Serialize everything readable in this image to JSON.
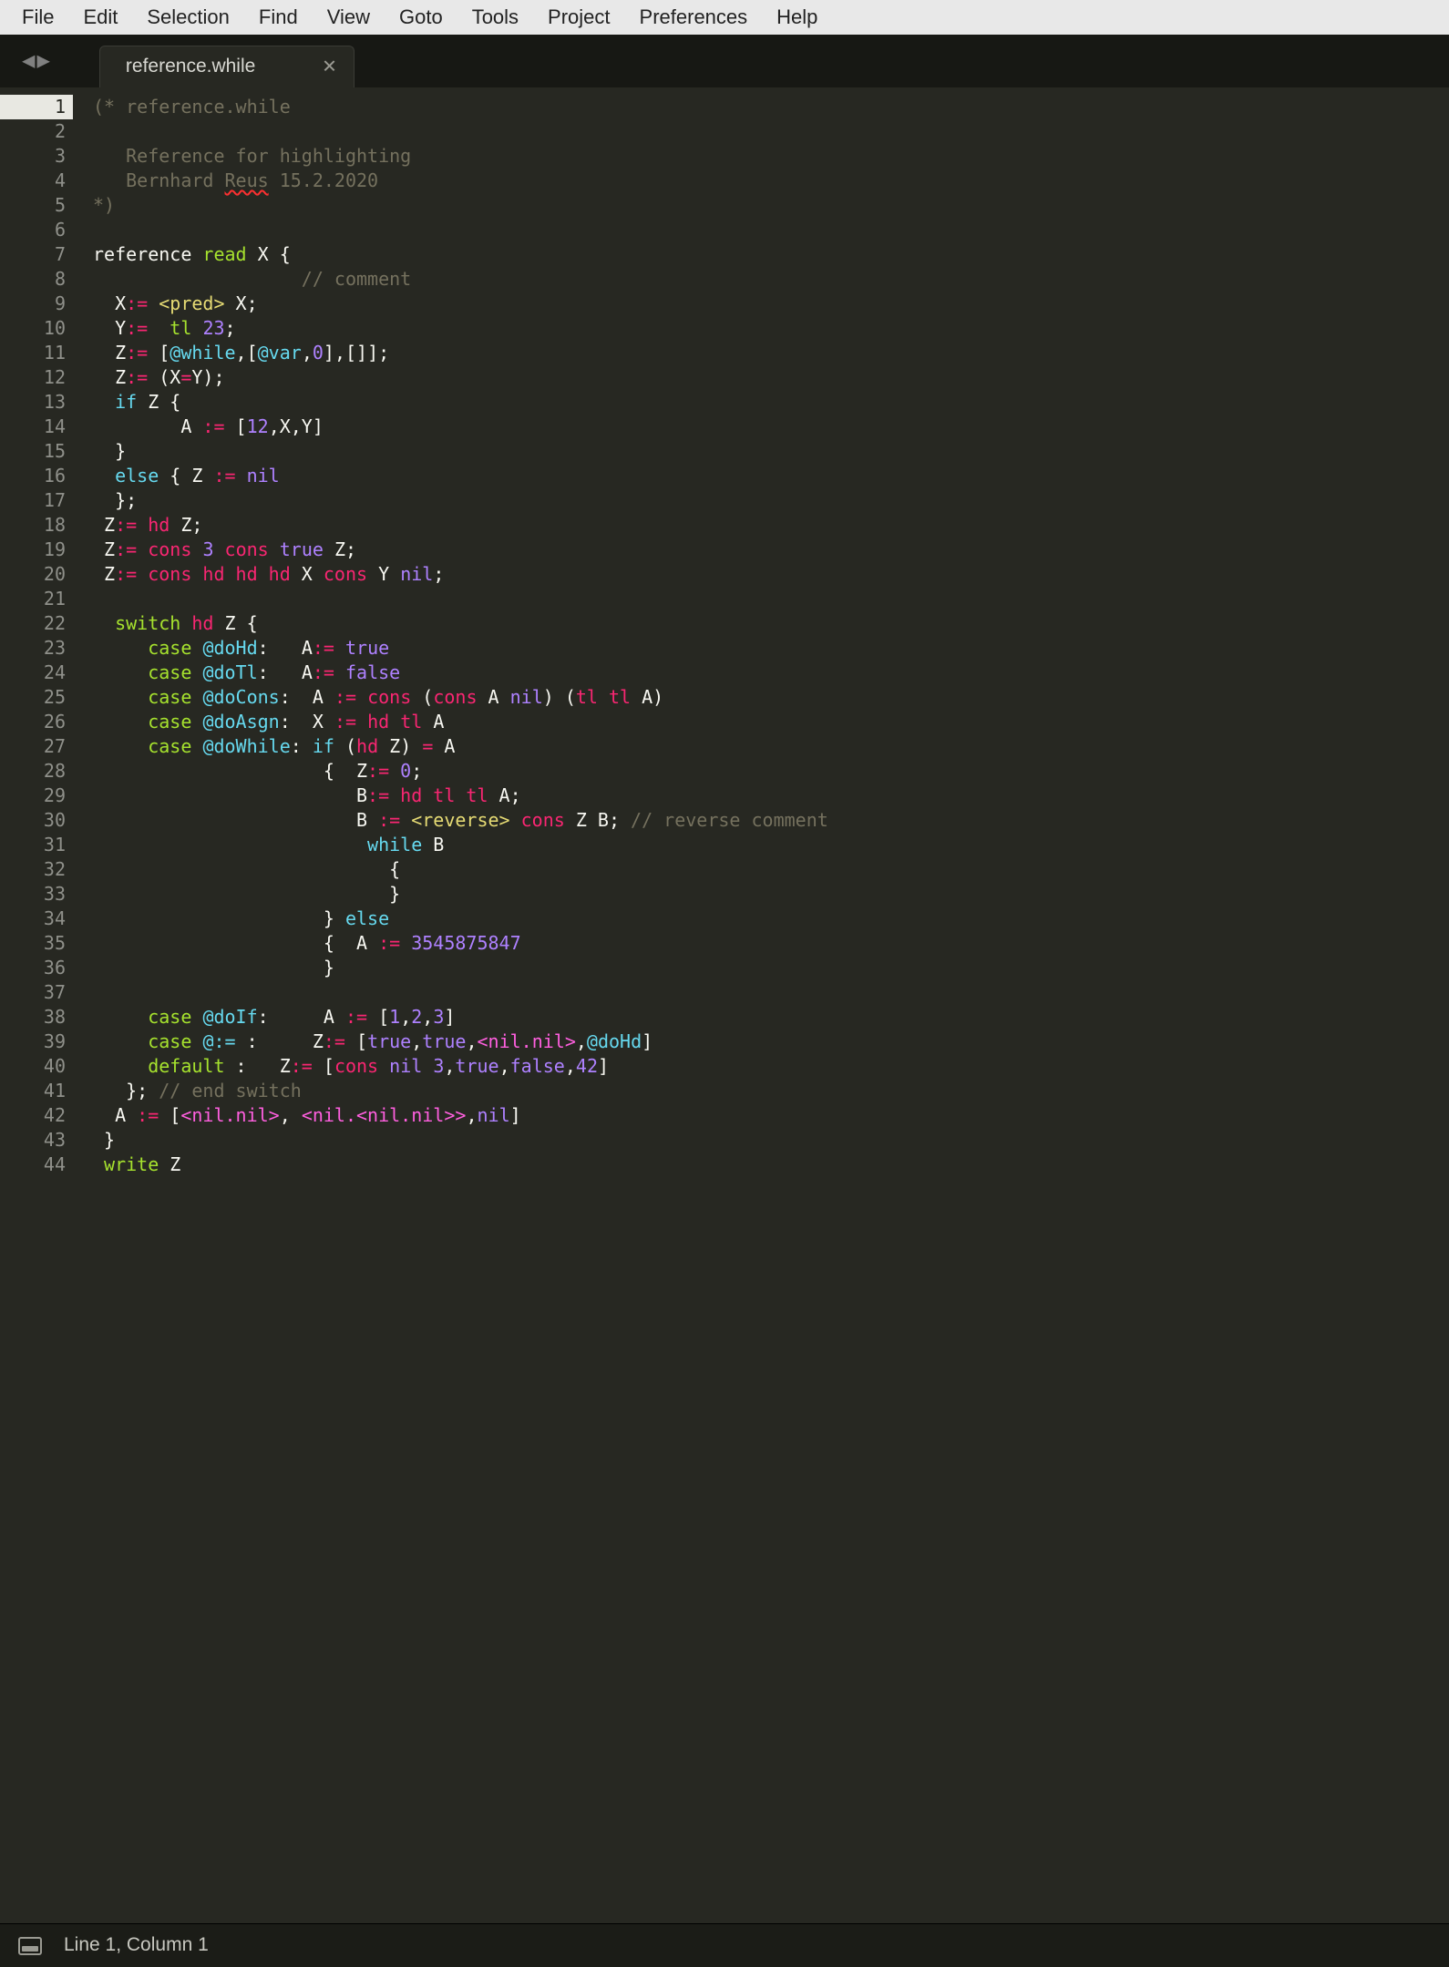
{
  "menu": {
    "items": [
      "File",
      "Edit",
      "Selection",
      "Find",
      "View",
      "Goto",
      "Tools",
      "Project",
      "Preferences",
      "Help"
    ]
  },
  "tabs": {
    "active": {
      "title": "reference.while"
    }
  },
  "nav": {
    "back": "◀",
    "forward": "▶"
  },
  "status": {
    "pos": "Line 1, Column 1"
  },
  "editor": {
    "line_count": 44,
    "current_line": 1
  },
  "code": {
    "l1": [
      [
        "c-cmt",
        "(* reference.while"
      ]
    ],
    "l2": [
      [
        "c-white",
        ""
      ]
    ],
    "l3": [
      [
        "c-cmt",
        "   Reference for highlighting"
      ]
    ],
    "l4": [
      [
        "c-cmt",
        "   Bernhard "
      ],
      [
        "c-cmt spell-err",
        "Reus"
      ],
      [
        "c-cmt",
        " 15.2.2020"
      ]
    ],
    "l5": [
      [
        "c-cmt",
        "*)"
      ]
    ],
    "l6": [
      [
        "c-white",
        ""
      ]
    ],
    "l7": [
      [
        "c-white",
        "reference "
      ],
      [
        "c-fn",
        "read"
      ],
      [
        "c-white",
        " X {"
      ]
    ],
    "l8": [
      [
        "c-white",
        "                   "
      ],
      [
        "c-cmt",
        "// comment"
      ]
    ],
    "l9": [
      [
        "c-white",
        "  X"
      ],
      [
        "c-red",
        ":= "
      ],
      [
        "c-yellow",
        "<pred>"
      ],
      [
        "c-white",
        " X;"
      ]
    ],
    "l10": [
      [
        "c-white",
        "  Y"
      ],
      [
        "c-red",
        ":=  "
      ],
      [
        "c-fn",
        "tl"
      ],
      [
        "c-white",
        " "
      ],
      [
        "c-purple",
        "23"
      ],
      [
        "c-white",
        ";"
      ]
    ],
    "l11": [
      [
        "c-white",
        "  Z"
      ],
      [
        "c-red",
        ":= "
      ],
      [
        "c-white",
        "["
      ],
      [
        "c-cyan",
        "@while"
      ],
      [
        "c-white",
        ",["
      ],
      [
        "c-cyan",
        "@var"
      ],
      [
        "c-white",
        ","
      ],
      [
        "c-purple",
        "0"
      ],
      [
        "c-white",
        "],[]];"
      ]
    ],
    "l12": [
      [
        "c-white",
        "  Z"
      ],
      [
        "c-red",
        ":= "
      ],
      [
        "c-white",
        "(X"
      ],
      [
        "c-red",
        "="
      ],
      [
        "c-white",
        "Y);"
      ]
    ],
    "l13": [
      [
        "c-cyan",
        "  if"
      ],
      [
        "c-white",
        " Z {"
      ]
    ],
    "l14": [
      [
        "c-white",
        "        A "
      ],
      [
        "c-red",
        ":= "
      ],
      [
        "c-white",
        "["
      ],
      [
        "c-purple",
        "12"
      ],
      [
        "c-white",
        ",X,Y]"
      ]
    ],
    "l15": [
      [
        "c-white",
        "  }"
      ]
    ],
    "l16": [
      [
        "c-cyan",
        "  else"
      ],
      [
        "c-white",
        " { Z "
      ],
      [
        "c-red",
        ":= "
      ],
      [
        "c-purple",
        "nil"
      ]
    ],
    "l17": [
      [
        "c-white",
        "  };"
      ]
    ],
    "l18": [
      [
        "c-white",
        " Z"
      ],
      [
        "c-red",
        ":= "
      ],
      [
        "c-red",
        "hd"
      ],
      [
        "c-white",
        " Z;"
      ]
    ],
    "l19": [
      [
        "c-white",
        " Z"
      ],
      [
        "c-red",
        ":= "
      ],
      [
        "c-red",
        "cons "
      ],
      [
        "c-purple",
        "3"
      ],
      [
        "c-white",
        " "
      ],
      [
        "c-red",
        "cons "
      ],
      [
        "c-purple",
        "true"
      ],
      [
        "c-white",
        " Z;"
      ]
    ],
    "l20": [
      [
        "c-white",
        " Z"
      ],
      [
        "c-red",
        ":= "
      ],
      [
        "c-red",
        "cons hd hd hd"
      ],
      [
        "c-white",
        " X "
      ],
      [
        "c-red",
        "cons"
      ],
      [
        "c-white",
        " Y "
      ],
      [
        "c-purple",
        "nil"
      ],
      [
        "c-white",
        ";"
      ]
    ],
    "l21": [
      [
        "c-white",
        ""
      ]
    ],
    "l22": [
      [
        "c-white",
        "  "
      ],
      [
        "c-fn",
        "switch"
      ],
      [
        "c-white",
        " "
      ],
      [
        "c-red",
        "hd"
      ],
      [
        "c-white",
        " Z {"
      ]
    ],
    "l23": [
      [
        "c-white",
        "     "
      ],
      [
        "c-fn",
        "case"
      ],
      [
        "c-white",
        " "
      ],
      [
        "c-cyan",
        "@doHd"
      ],
      [
        "c-white",
        ":   A"
      ],
      [
        "c-red",
        ":= "
      ],
      [
        "c-purple",
        "true"
      ]
    ],
    "l24": [
      [
        "c-white",
        "     "
      ],
      [
        "c-fn",
        "case"
      ],
      [
        "c-white",
        " "
      ],
      [
        "c-cyan",
        "@doTl"
      ],
      [
        "c-white",
        ":   A"
      ],
      [
        "c-red",
        ":= "
      ],
      [
        "c-purple",
        "false"
      ]
    ],
    "l25": [
      [
        "c-white",
        "     "
      ],
      [
        "c-fn",
        "case"
      ],
      [
        "c-white",
        " "
      ],
      [
        "c-cyan",
        "@doCons"
      ],
      [
        "c-white",
        ":  A "
      ],
      [
        "c-red",
        ":= cons "
      ],
      [
        "c-white",
        "("
      ],
      [
        "c-red",
        "cons"
      ],
      [
        "c-white",
        " A "
      ],
      [
        "c-purple",
        "nil"
      ],
      [
        "c-white",
        ") ("
      ],
      [
        "c-red",
        "tl tl"
      ],
      [
        "c-white",
        " A)"
      ]
    ],
    "l26": [
      [
        "c-white",
        "     "
      ],
      [
        "c-fn",
        "case"
      ],
      [
        "c-white",
        " "
      ],
      [
        "c-cyan",
        "@doAsgn"
      ],
      [
        "c-white",
        ":  X "
      ],
      [
        "c-red",
        ":= hd tl"
      ],
      [
        "c-white",
        " A"
      ]
    ],
    "l27": [
      [
        "c-white",
        "     "
      ],
      [
        "c-fn",
        "case"
      ],
      [
        "c-white",
        " "
      ],
      [
        "c-cyan",
        "@doWhile"
      ],
      [
        "c-white",
        ": "
      ],
      [
        "c-cyan",
        "if"
      ],
      [
        "c-white",
        " ("
      ],
      [
        "c-red",
        "hd"
      ],
      [
        "c-white",
        " Z) "
      ],
      [
        "c-red",
        "="
      ],
      [
        "c-white",
        " A"
      ]
    ],
    "l28": [
      [
        "c-white",
        "                     {  Z"
      ],
      [
        "c-red",
        ":= "
      ],
      [
        "c-purple",
        "0"
      ],
      [
        "c-white",
        ";"
      ]
    ],
    "l29": [
      [
        "c-white",
        "                        B"
      ],
      [
        "c-red",
        ":= hd tl tl"
      ],
      [
        "c-white",
        " A;"
      ]
    ],
    "l30": [
      [
        "c-white",
        "                        B "
      ],
      [
        "c-red",
        ":= "
      ],
      [
        "c-yellow",
        "<reverse>"
      ],
      [
        "c-white",
        " "
      ],
      [
        "c-red",
        "cons"
      ],
      [
        "c-white",
        " Z B; "
      ],
      [
        "c-cmt",
        "// reverse comment"
      ]
    ],
    "l31": [
      [
        "c-white",
        "                         "
      ],
      [
        "c-cyan",
        "while"
      ],
      [
        "c-white",
        " B"
      ]
    ],
    "l32": [
      [
        "c-white",
        "                           {"
      ]
    ],
    "l33": [
      [
        "c-white",
        "                           }"
      ]
    ],
    "l34": [
      [
        "c-white",
        "                     } "
      ],
      [
        "c-cyan",
        "else"
      ]
    ],
    "l35": [
      [
        "c-white",
        "                     {  A "
      ],
      [
        "c-red",
        ":= "
      ],
      [
        "c-purple",
        "3545875847"
      ]
    ],
    "l36": [
      [
        "c-white",
        "                     }"
      ]
    ],
    "l37": [
      [
        "c-white",
        ""
      ]
    ],
    "l38": [
      [
        "c-white",
        "     "
      ],
      [
        "c-fn",
        "case"
      ],
      [
        "c-white",
        " "
      ],
      [
        "c-cyan",
        "@doIf"
      ],
      [
        "c-white",
        ":     A "
      ],
      [
        "c-red",
        ":= "
      ],
      [
        "c-white",
        "["
      ],
      [
        "c-purple",
        "1"
      ],
      [
        "c-white",
        ","
      ],
      [
        "c-purple",
        "2"
      ],
      [
        "c-white",
        ","
      ],
      [
        "c-purple",
        "3"
      ],
      [
        "c-white",
        "]"
      ]
    ],
    "l39": [
      [
        "c-white",
        "     "
      ],
      [
        "c-fn",
        "case"
      ],
      [
        "c-white",
        " "
      ],
      [
        "c-cyan",
        "@:="
      ],
      [
        "c-white",
        " :     Z"
      ],
      [
        "c-red",
        ":= "
      ],
      [
        "c-white",
        "["
      ],
      [
        "c-purple",
        "true"
      ],
      [
        "c-white",
        ","
      ],
      [
        "c-purple",
        "true"
      ],
      [
        "c-white",
        ","
      ],
      [
        "c-magenta",
        "<nil.nil>"
      ],
      [
        "c-white",
        ","
      ],
      [
        "c-cyan",
        "@doHd"
      ],
      [
        "c-white",
        "]"
      ]
    ],
    "l40": [
      [
        "c-white",
        "     "
      ],
      [
        "c-fn",
        "default"
      ],
      [
        "c-white",
        " :   Z"
      ],
      [
        "c-red",
        ":= "
      ],
      [
        "c-white",
        "["
      ],
      [
        "c-red",
        "cons "
      ],
      [
        "c-purple",
        "nil"
      ],
      [
        "c-white",
        " "
      ],
      [
        "c-purple",
        "3"
      ],
      [
        "c-white",
        ","
      ],
      [
        "c-purple",
        "true"
      ],
      [
        "c-white",
        ","
      ],
      [
        "c-purple",
        "false"
      ],
      [
        "c-white",
        ","
      ],
      [
        "c-purple",
        "42"
      ],
      [
        "c-white",
        "]"
      ]
    ],
    "l41": [
      [
        "c-white",
        "   }; "
      ],
      [
        "c-cmt",
        "// end switch"
      ]
    ],
    "l42": [
      [
        "c-white",
        "  A "
      ],
      [
        "c-red",
        ":= "
      ],
      [
        "c-white",
        "["
      ],
      [
        "c-magenta",
        "<nil.nil>"
      ],
      [
        "c-white",
        ", "
      ],
      [
        "c-magenta",
        "<nil.<nil.nil>>"
      ],
      [
        "c-white",
        ","
      ],
      [
        "c-purple",
        "nil"
      ],
      [
        "c-white",
        "]"
      ]
    ],
    "l43": [
      [
        "c-white",
        " }"
      ]
    ],
    "l44": [
      [
        "c-white",
        " "
      ],
      [
        "c-fn",
        "write"
      ],
      [
        "c-white",
        " Z"
      ]
    ]
  }
}
